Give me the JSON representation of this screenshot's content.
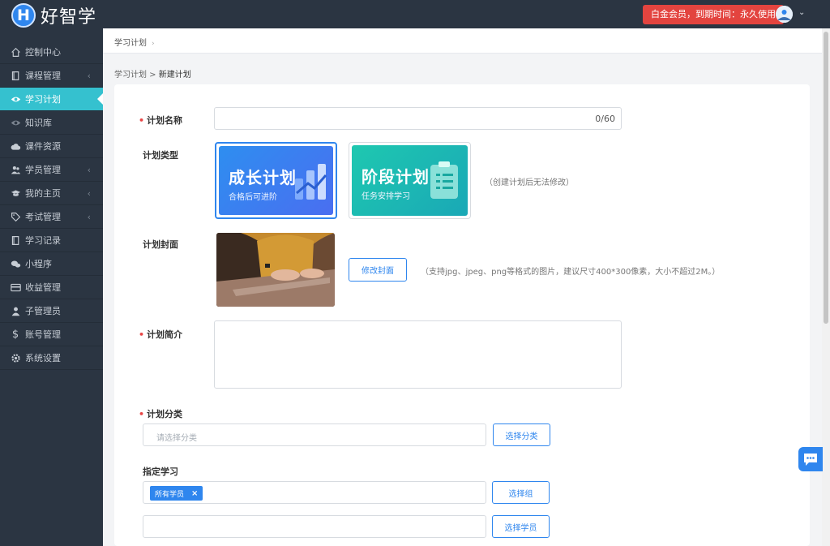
{
  "app": {
    "logo_letter": "H",
    "name": "好智学"
  },
  "header": {
    "vip_text": "白金会员，到期时间：永久使用"
  },
  "sidebar": {
    "items": [
      {
        "label": "控制中心",
        "icon": "home-icon"
      },
      {
        "label": "课程管理",
        "icon": "book-icon"
      },
      {
        "label": "学习计划",
        "icon": "eye-icon"
      },
      {
        "label": "知识库",
        "icon": "eye-icon"
      },
      {
        "label": "课件资源",
        "icon": "cloud-icon"
      },
      {
        "label": "学员管理",
        "icon": "users-icon"
      },
      {
        "label": "我的主页",
        "icon": "graduation-cap-icon"
      },
      {
        "label": "考试管理",
        "icon": "tag-icon"
      },
      {
        "label": "学习记录",
        "icon": "book-icon"
      },
      {
        "label": "小程序",
        "icon": "wechat-icon"
      },
      {
        "label": "收益管理",
        "icon": "credit-card-icon"
      },
      {
        "label": "子管理员",
        "icon": "user-icon"
      },
      {
        "label": "账号管理",
        "icon": "dollar-icon"
      },
      {
        "label": "系统设置",
        "icon": "gear-icon"
      }
    ]
  },
  "tabs": [
    {
      "label": "学习计划"
    }
  ],
  "breadcrumb": {
    "parent": "学习计划 > ",
    "current": "新建计划"
  },
  "form": {
    "name": {
      "label": "计划名称",
      "counter": "0/60"
    },
    "type": {
      "label": "计划类型",
      "options": [
        {
          "title": "成长计划",
          "subtitle": "合格后可进阶"
        },
        {
          "title": "阶段计划",
          "subtitle": "任务安排学习"
        }
      ],
      "hint": "（创建计划后无法修改）"
    },
    "cover": {
      "label": "计划封面",
      "button": "修改封面",
      "hint": "（支持jpg、jpeg、png等格式的图片，建议尺寸400*300像素，大小不超过2M。）"
    },
    "intro": {
      "label": "计划简介"
    },
    "category": {
      "label": "计划分类",
      "placeholder": "请选择分类",
      "button": "选择分类"
    },
    "assign": {
      "label": "指定学习",
      "tag": "所有学员",
      "group_button": "选择组",
      "student_button": "选择学员"
    }
  },
  "colors": {
    "primary": "#2f86ee",
    "sidebar_bg": "#2b3542",
    "active": "#35c1cf",
    "danger": "#e3443f"
  }
}
